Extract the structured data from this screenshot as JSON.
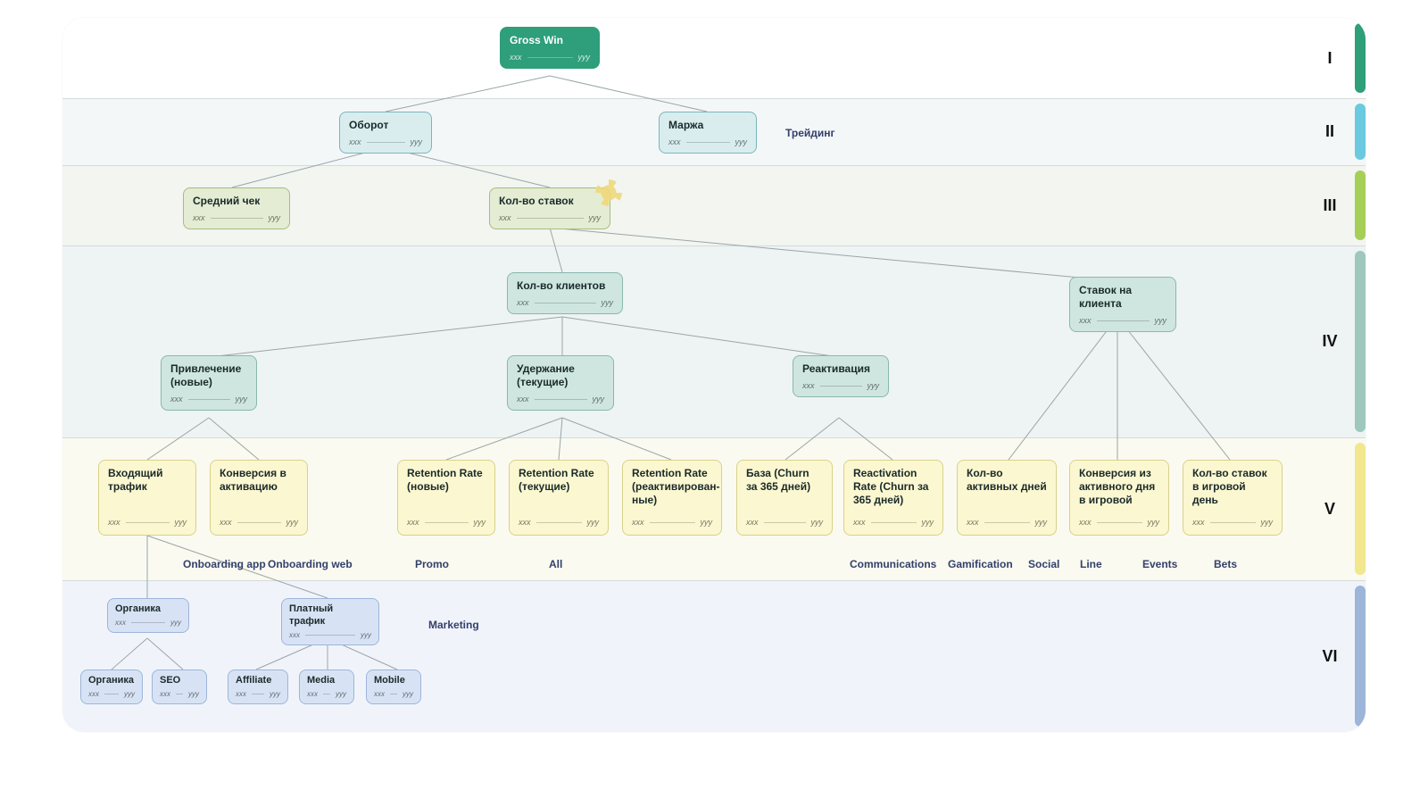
{
  "placeholders": {
    "left": "xxx",
    "right": "yyy"
  },
  "levels": [
    "I",
    "II",
    "III",
    "IV",
    "V",
    "VI"
  ],
  "nodes": {
    "grosswin": {
      "title": "Gross Win"
    },
    "turnover": {
      "title": "Оборот"
    },
    "margin": {
      "title": "Маржа"
    },
    "avgcheck": {
      "title": "Средний чек"
    },
    "betcount": {
      "title": "Кол-во ставок"
    },
    "clients": {
      "title": "Кол-во клиентов"
    },
    "betsperclient": {
      "title": "Ставок на клиента"
    },
    "acquire": {
      "title": "Привлечение (новые)"
    },
    "retain": {
      "title": "Удержание (текущие)"
    },
    "react": {
      "title": "Реактивация"
    },
    "incoming": {
      "title": "Входящий трафик"
    },
    "conv_act": {
      "title": "Конверсия в активацию"
    },
    "rr_new": {
      "title": "Retention Rate (новые)"
    },
    "rr_cur": {
      "title": "Retention Rate (текущие)"
    },
    "rr_react": {
      "title": "Retention Rate (реактивирован-ные)"
    },
    "base": {
      "title": "База (Churn за 365 дней)"
    },
    "react_rate": {
      "title": "Reactivation Rate (Churn за 365 дней)"
    },
    "actdays": {
      "title": "Кол-во активных дней"
    },
    "convday": {
      "title": "Конверсия из активного дня в игровой"
    },
    "betsgame": {
      "title": "Кол-во ставок в игровой день"
    },
    "organic": {
      "title": "Органика"
    },
    "paid": {
      "title": "Платный трафик"
    },
    "organic2": {
      "title": "Органика"
    },
    "seo": {
      "title": "SEO"
    },
    "affiliate": {
      "title": "Affiliate"
    },
    "media": {
      "title": "Media"
    },
    "mobile": {
      "title": "Mobile"
    }
  },
  "labels": {
    "trading": "Трейдинг",
    "onb_app": "Onboarding app",
    "onb_web": "Onboarding web",
    "promo": "Promo",
    "all": "All",
    "comm": "Communications",
    "gami": "Gamification",
    "social": "Social",
    "line": "Line",
    "events": "Events",
    "bets": "Bets",
    "marketing": "Marketing"
  }
}
